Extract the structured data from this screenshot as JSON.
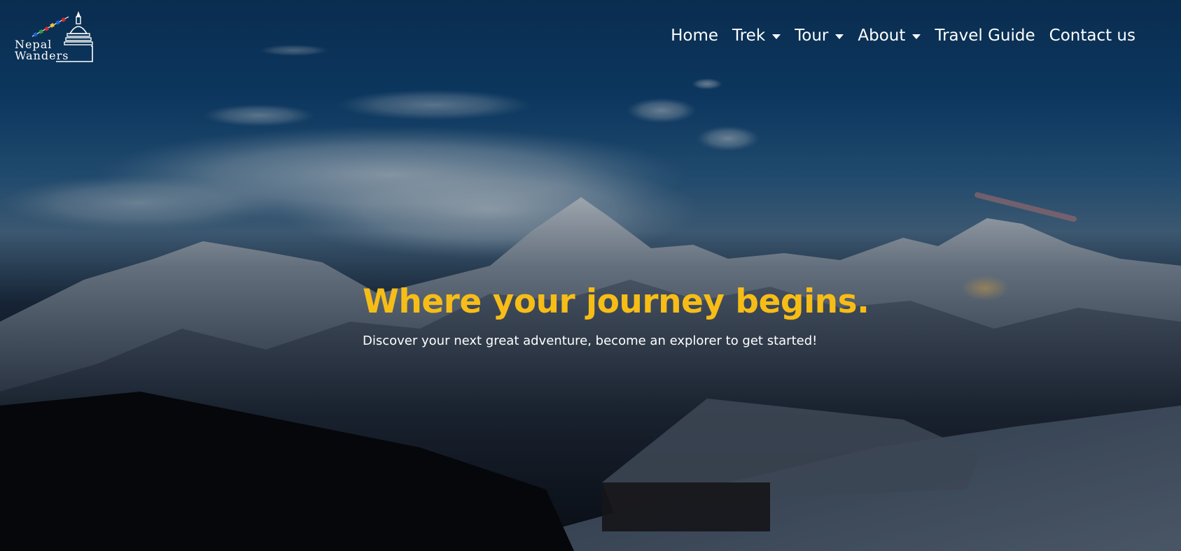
{
  "brand": {
    "line1": "Nepal",
    "line2": "Wanders",
    "prayer_flag_colors": [
      "#1f5fd1",
      "#ffffff",
      "#d62a2a",
      "#2e9b3c",
      "#f2c12e"
    ]
  },
  "nav": {
    "items": [
      {
        "label": "Home",
        "dropdown": false
      },
      {
        "label": "Trek",
        "dropdown": true
      },
      {
        "label": "Tour",
        "dropdown": true
      },
      {
        "label": "About",
        "dropdown": true
      },
      {
        "label": "Travel Guide",
        "dropdown": false
      },
      {
        "label": "Contact us",
        "dropdown": false
      }
    ]
  },
  "hero": {
    "title": "Where your journey begins.",
    "subtitle": "Discover your next great adventure, become an explorer to get started!"
  },
  "colors": {
    "accent": "#f7bd17",
    "text": "#ffffff"
  }
}
